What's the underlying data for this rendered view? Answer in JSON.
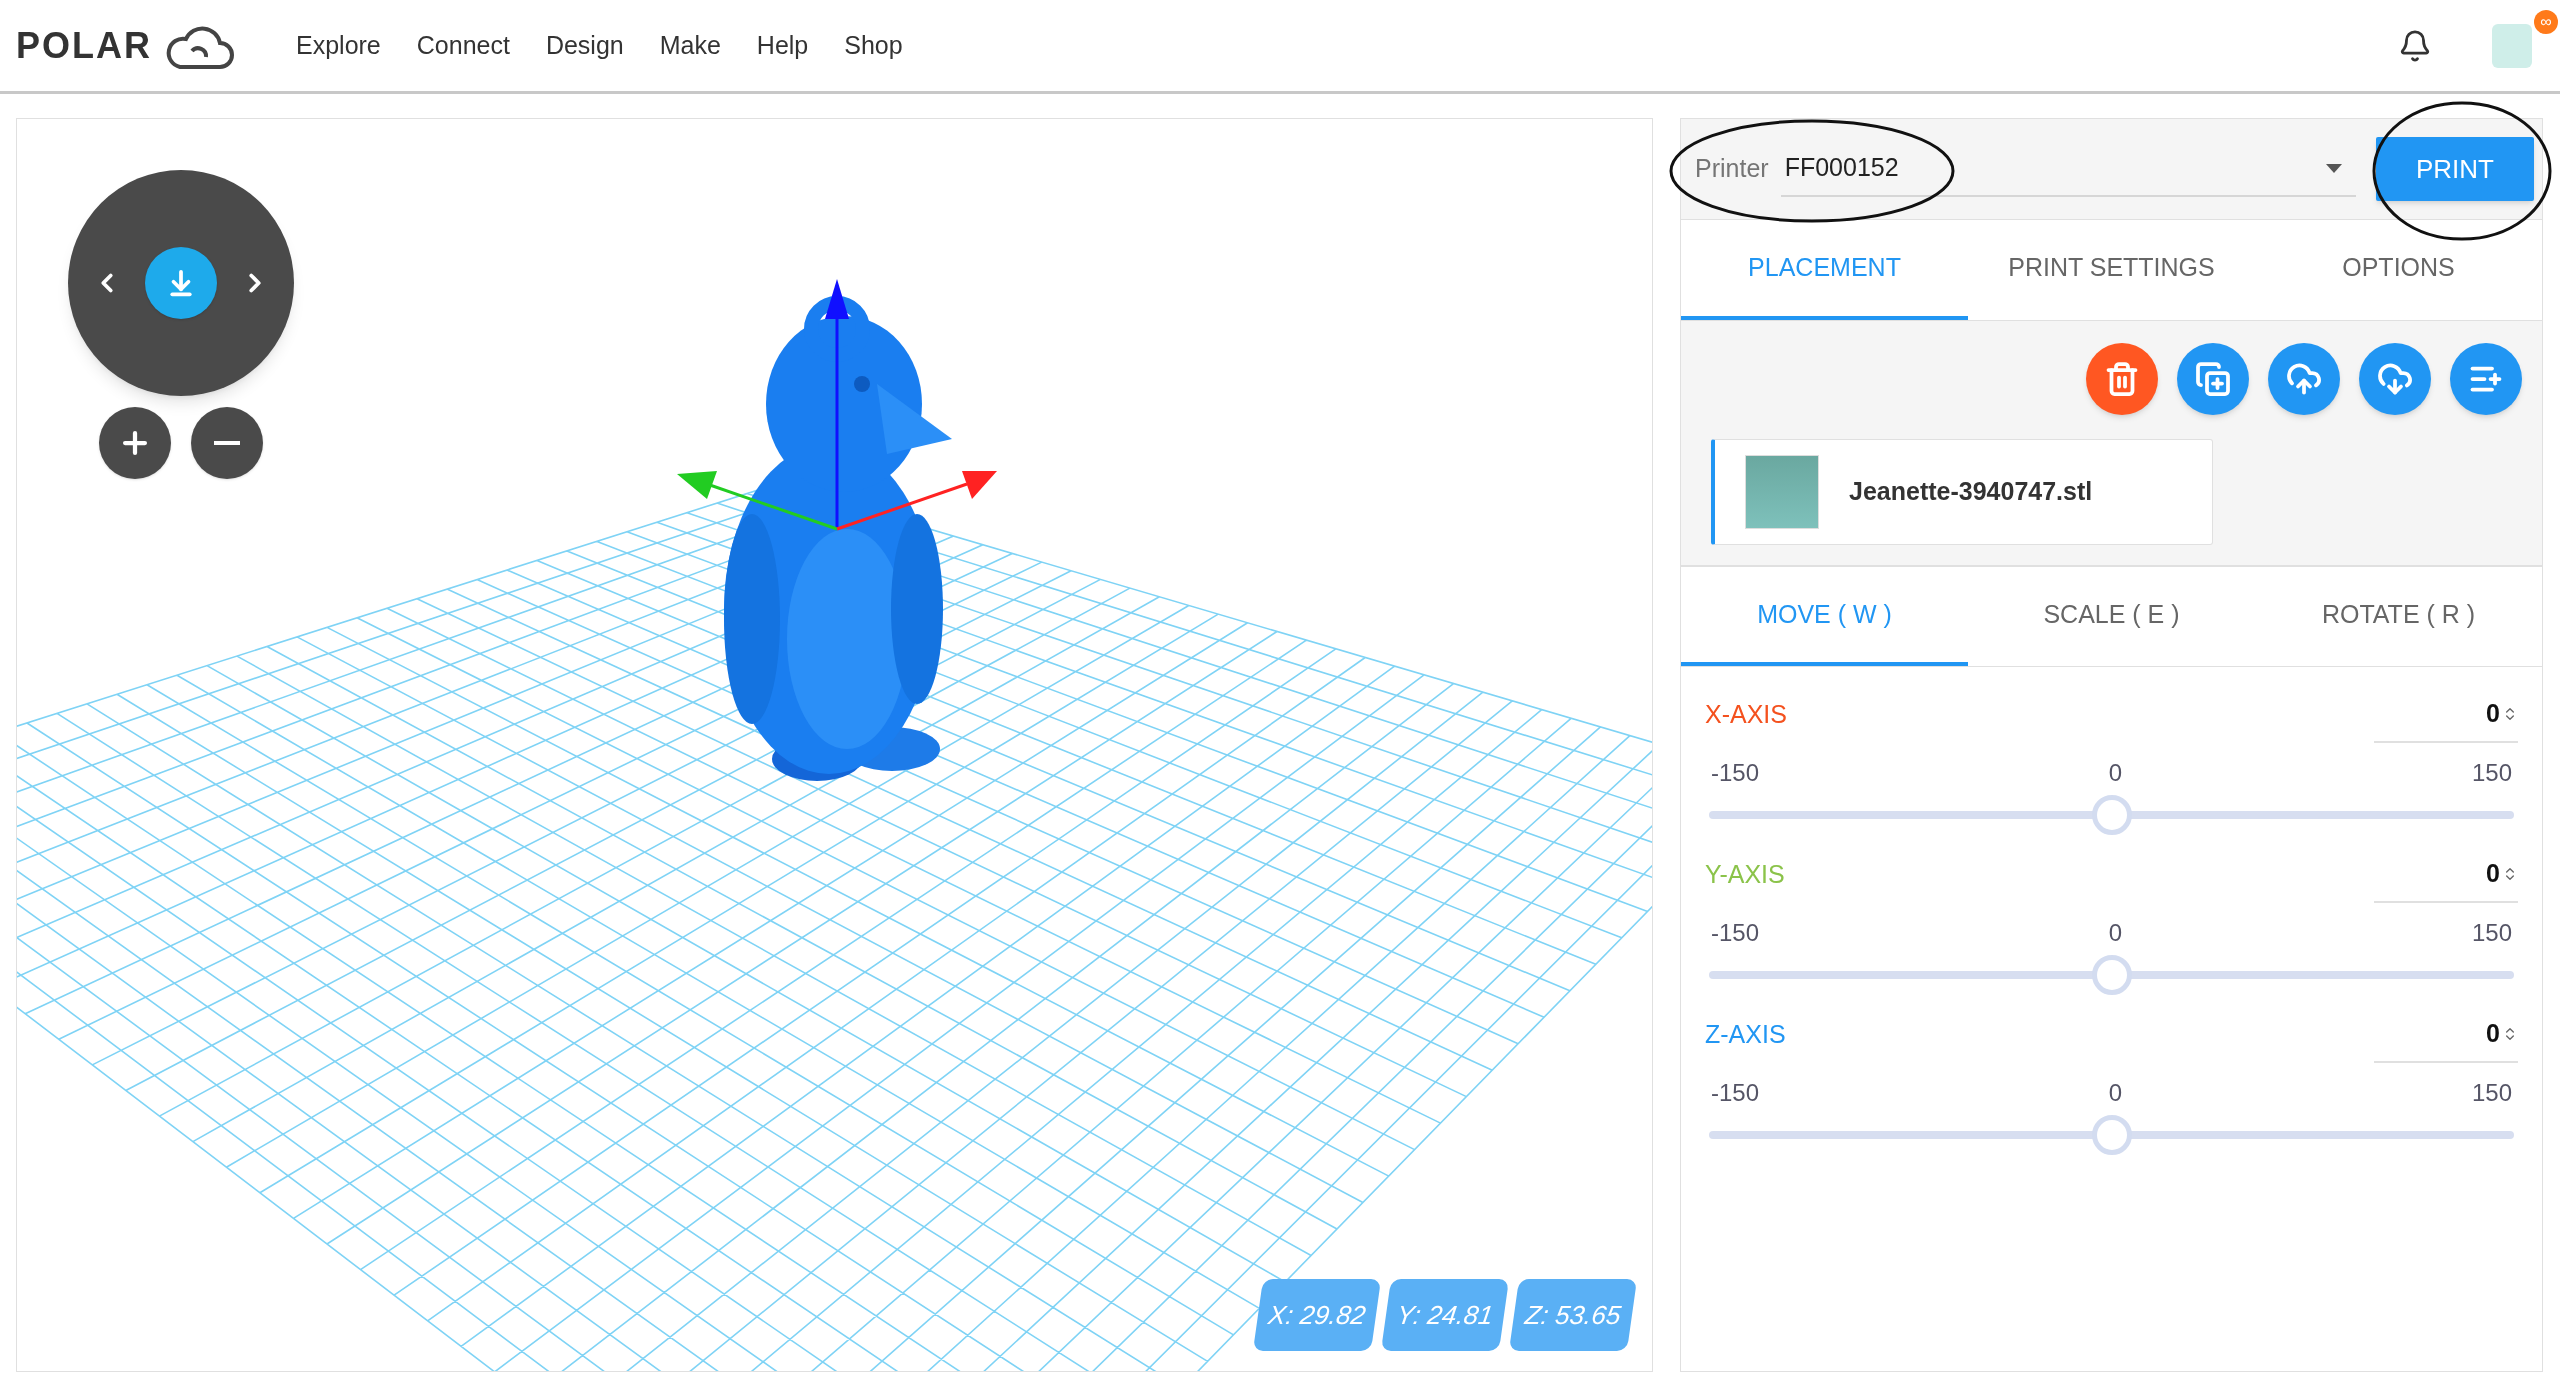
{
  "header": {
    "logo": "POLAR",
    "nav": [
      "Explore",
      "Connect",
      "Design",
      "Make",
      "Help",
      "Shop"
    ],
    "avatar_badge": "∞"
  },
  "viewport": {
    "coordinates": [
      "X: 29.82",
      "Y: 24.81",
      "Z: 53.65"
    ]
  },
  "printer": {
    "label": "Printer",
    "value": "FF000152",
    "print_button": "PRINT"
  },
  "tabs": [
    {
      "label": "PLACEMENT",
      "selected": true
    },
    {
      "label": "PRINT SETTINGS",
      "selected": false
    },
    {
      "label": "OPTIONS",
      "selected": false
    }
  ],
  "actions": [
    {
      "kind": "delete"
    },
    {
      "kind": "duplicate"
    },
    {
      "kind": "upload"
    },
    {
      "kind": "download"
    },
    {
      "kind": "add-list"
    }
  ],
  "file": {
    "name": "Jeanette-3940747.stl",
    "selected": true
  },
  "transform_tabs": [
    {
      "label": "MOVE ( W )",
      "selected": true
    },
    {
      "label": "SCALE ( E )",
      "selected": false
    },
    {
      "label": "ROTATE ( R )",
      "selected": false
    }
  ],
  "axes": [
    {
      "label": "X-AXIS",
      "color": "#f4511e",
      "value": "0",
      "min": "-150",
      "mid": "0",
      "max": "150",
      "level": 0.5
    },
    {
      "label": "Y-AXIS",
      "color": "#8bc34a",
      "value": "0",
      "min": "-150",
      "mid": "0",
      "max": "150",
      "level": 0.5
    },
    {
      "label": "Z-AXIS",
      "color": "#2196f3",
      "value": "0",
      "min": "-150",
      "mid": "0",
      "max": "150",
      "level": 0.5
    }
  ]
}
